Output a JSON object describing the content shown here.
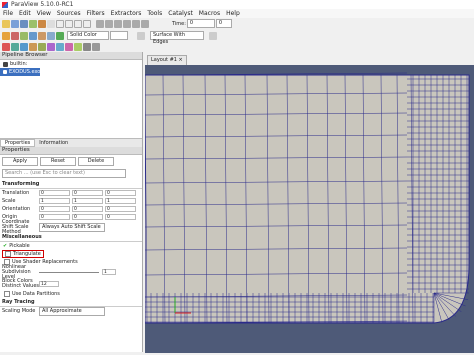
{
  "app": {
    "title": "ParaView 5.10.0-RC1"
  },
  "menu": [
    "File",
    "Edit",
    "View",
    "Sources",
    "Filters",
    "Extractors",
    "Tools",
    "Catalyst",
    "Macros",
    "Help"
  ],
  "toolbar": {
    "time_label": "Time:",
    "time_value": "0",
    "time_step": "0",
    "coloring": "Solid Color",
    "representation": "Surface With Edges"
  },
  "pipeline": {
    "header": "Pipeline Browser",
    "builtin": "builtin:",
    "source": "EXODUS.exo"
  },
  "properties": {
    "tabs": [
      "Properties",
      "Information"
    ],
    "header": "Properties",
    "apply": "Apply",
    "reset": "Reset",
    "delete": "Delete",
    "search_placeholder": "Search ... (use Esc to clear text)",
    "transforming": "Transforming",
    "rows": [
      {
        "label": "Translation",
        "v": [
          "0",
          "0",
          "0"
        ]
      },
      {
        "label": "Scale",
        "v": [
          "1",
          "1",
          "1"
        ]
      },
      {
        "label": "Orientation",
        "v": [
          "0",
          "0",
          "0"
        ]
      },
      {
        "label": "Origin",
        "v": [
          "0",
          "0",
          "0"
        ]
      }
    ],
    "coord_shift": "Coordinate Shift Scale Method",
    "coord_shift_value": "Always Auto Shift Scale",
    "misc": "Miscellaneous",
    "pickable": "Pickable",
    "triangulate": "Triangulate",
    "shader": "Use Shader Replacements",
    "nonlinear": "Nonlinear Subdivision Level",
    "nonlinear_value": "1",
    "block_colors": "Block Colors Distinct Values",
    "block_colors_value": "12",
    "data_partitions": "Use Data Partitions",
    "ray_tracing": "Ray Tracing",
    "scaling_mode": "Scaling Mode",
    "scaling_value": "All Approximate"
  },
  "view": {
    "tab": "Layout #1"
  },
  "colors": {
    "mesh_bg": "#c9c6bd",
    "mesh_line": "#2a2a8a",
    "triangulate_border": "#d00000"
  }
}
